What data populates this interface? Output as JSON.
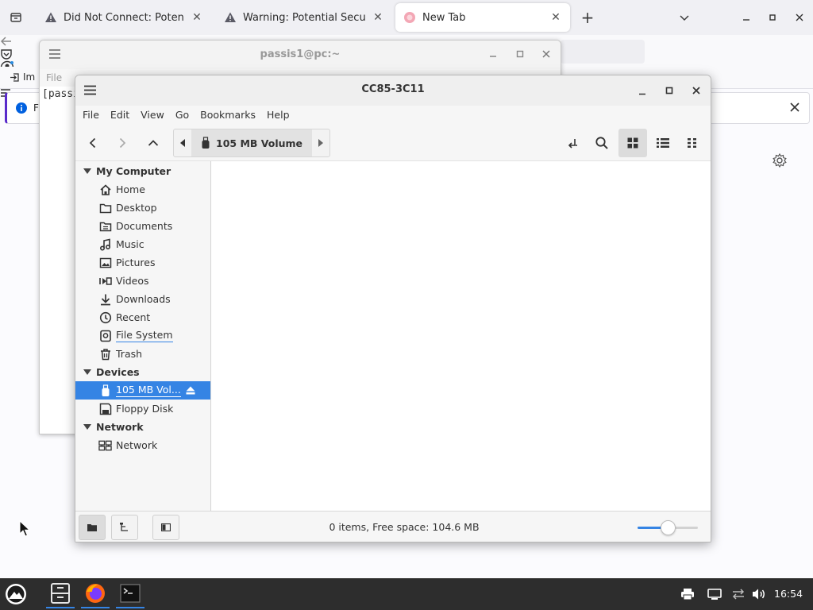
{
  "browser": {
    "tabs": [
      {
        "title": "Did Not Connect: Potential Se",
        "icon": "warning-icon"
      },
      {
        "title": "Warning: Potential Security R",
        "icon": "warning-icon"
      },
      {
        "title": "New Tab",
        "icon": "firefox-icon",
        "active": true
      }
    ],
    "bookmark_partial": "Im",
    "notification_partial": "Fi"
  },
  "terminal": {
    "title": "passis1@pc:~",
    "menu_label": "File",
    "text": "[passi"
  },
  "file_manager": {
    "title": "CC85-3C11",
    "menu": [
      "File",
      "Edit",
      "View",
      "Go",
      "Bookmarks",
      "Help"
    ],
    "location": "105 MB Volume",
    "sidebar": {
      "my_computer": {
        "header": "My Computer",
        "items": [
          {
            "label": "Home",
            "icon": "home-icon"
          },
          {
            "label": "Desktop",
            "icon": "folder-icon"
          },
          {
            "label": "Documents",
            "icon": "document-icon"
          },
          {
            "label": "Music",
            "icon": "music-icon"
          },
          {
            "label": "Pictures",
            "icon": "picture-icon"
          },
          {
            "label": "Videos",
            "icon": "video-icon"
          },
          {
            "label": "Downloads",
            "icon": "download-icon"
          },
          {
            "label": "Recent",
            "icon": "clock-icon"
          },
          {
            "label": "File System",
            "icon": "disk-icon"
          },
          {
            "label": "Trash",
            "icon": "trash-icon"
          }
        ]
      },
      "devices": {
        "header": "Devices",
        "items": [
          {
            "label": "105 MB Vol...",
            "icon": "usb-icon",
            "selected": true
          },
          {
            "label": "Floppy Disk",
            "icon": "floppy-icon"
          }
        ]
      },
      "network": {
        "header": "Network",
        "items": [
          {
            "label": "Network",
            "icon": "network-icon"
          }
        ]
      }
    },
    "status": "0 items, Free space: 104.6 MB",
    "zoom_fraction": 0.5
  },
  "taskbar": {
    "clock": "16:54"
  },
  "colors": {
    "accent": "#3584e4",
    "taskbar": "#2d2d2d"
  }
}
